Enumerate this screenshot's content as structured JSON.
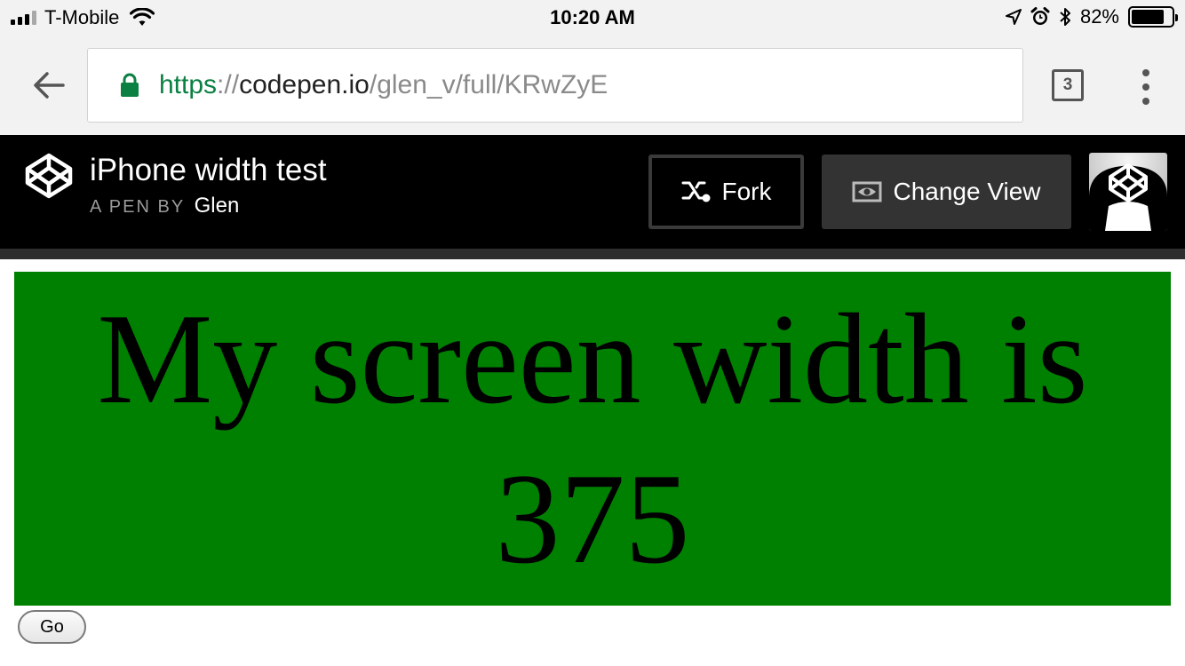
{
  "status_bar": {
    "carrier": "T-Mobile",
    "time": "10:20 AM",
    "battery_percent": "82%",
    "battery_level": 0.82,
    "signal_bars_filled": 3,
    "signal_bars_total": 4,
    "icons": [
      "cellular-signal-icon",
      "wifi-icon",
      "location-arrow-icon",
      "alarm-icon",
      "bluetooth-icon",
      "battery-icon"
    ]
  },
  "browser": {
    "url_scheme": "https",
    "url_separator": "://",
    "url_host": "codepen.io",
    "url_path": "/glen_v/full/KRwZyE",
    "tab_count": "3",
    "accent_secure": "#0b8043"
  },
  "codepen": {
    "pen_title": "iPhone width test",
    "byline_prefix": "A PEN BY",
    "author": "Glen",
    "fork_label": "Fork",
    "change_view_label": "Change View"
  },
  "page": {
    "heading": "My screen width is 375",
    "button_label": "Go",
    "box_color": "#008000"
  }
}
